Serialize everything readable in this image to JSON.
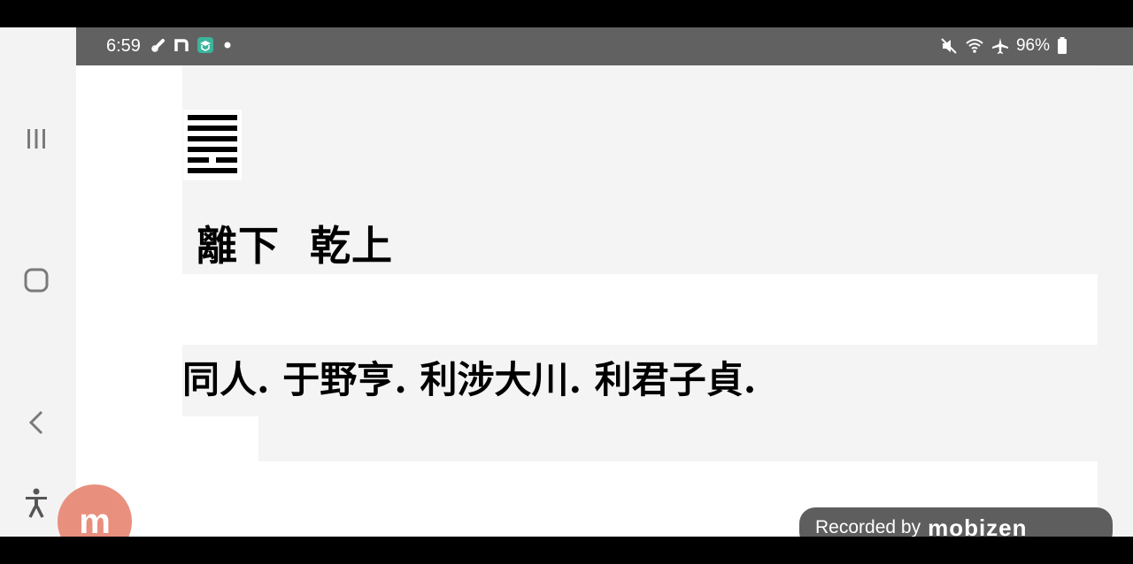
{
  "status_bar": {
    "time": "6:59",
    "notification_icons": [
      "link-icon",
      "n-app-icon",
      "green-app-icon",
      "dot-icon"
    ],
    "right_icons": [
      "mute-icon",
      "wifi-icon",
      "airplane-icon"
    ],
    "battery": "96%"
  },
  "nav": {
    "items": [
      "recents-button",
      "home-button",
      "back-button",
      "accessibility-button"
    ]
  },
  "content": {
    "hexagram_name": "同人",
    "trigrams": "離下  乾上",
    "judgment": "同人. 于野亨. 利涉大川. 利君子貞."
  },
  "overlay": {
    "badge_letter": "m",
    "recorded_label": "Recorded by",
    "recorded_brand": "mobizen"
  },
  "colors": {
    "status_bg": "#616161",
    "panel_bg": "#f4f4f4",
    "badge": "#e88a78"
  }
}
